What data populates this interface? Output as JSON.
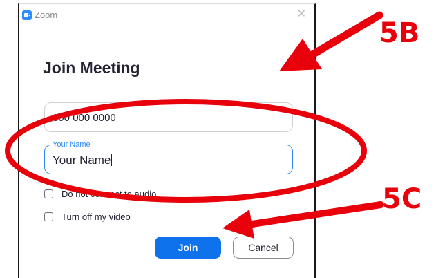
{
  "window": {
    "app_title": "Zoom",
    "app_icon": "zoom-camera-icon",
    "close_glyph": "✕"
  },
  "dialog": {
    "heading": "Join Meeting",
    "meeting_id": {
      "value": "000 000 0000"
    },
    "name_field": {
      "label": "Your Name",
      "value": "Your Name"
    },
    "options": [
      {
        "label": "Do not connect to audio",
        "checked": false
      },
      {
        "label": "Turn off my video",
        "checked": false
      }
    ],
    "buttons": {
      "join": "Join",
      "cancel": "Cancel"
    }
  },
  "annotations": {
    "label_5b": "5B",
    "label_5c": "5C",
    "color": "#e8000b"
  },
  "colors": {
    "accent": "#2d8cff",
    "join_button": "#0e72ed"
  }
}
